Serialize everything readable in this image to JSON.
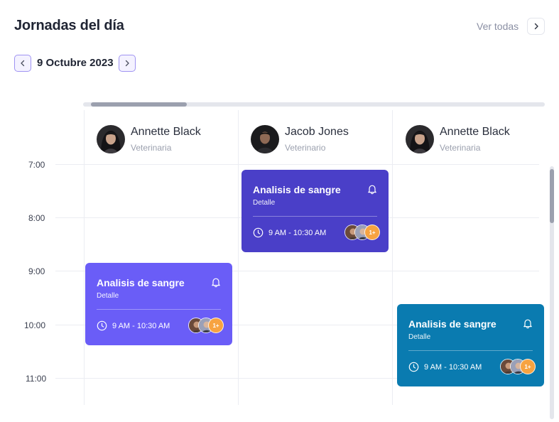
{
  "header": {
    "title": "Jornadas del día",
    "see_all_label": "Ver todas"
  },
  "date_nav": {
    "date": "9 Octubre 2023"
  },
  "times": [
    "7:00",
    "8:00",
    "9:00",
    "10:00",
    "11:00"
  ],
  "staff": [
    {
      "name": "Annette Black",
      "role": "Veterinaria"
    },
    {
      "name": "Jacob Jones",
      "role": "Veterinario"
    },
    {
      "name": "Annette Black",
      "role": "Veterinaria"
    }
  ],
  "events": [
    {
      "title": "Analisis de sangre",
      "detail": "Detalle",
      "time": "9 AM - 10:30 AM",
      "more": "1+",
      "color": "#6a5df7"
    },
    {
      "title": "Analisis de sangre",
      "detail": "Detalle",
      "time": "9 AM - 10:30 AM",
      "more": "1+",
      "color": "#4a3fc8"
    },
    {
      "title": "Analisis de sangre",
      "detail": "Detalle",
      "time": "9 AM - 10:30 AM",
      "more": "1+",
      "color": "#0a7bb0"
    }
  ],
  "colors": {
    "accent": "#6a5df7",
    "event_dark": "#4a3fc8",
    "event_blue": "#0a7bb0",
    "badge": "#f7a341"
  }
}
